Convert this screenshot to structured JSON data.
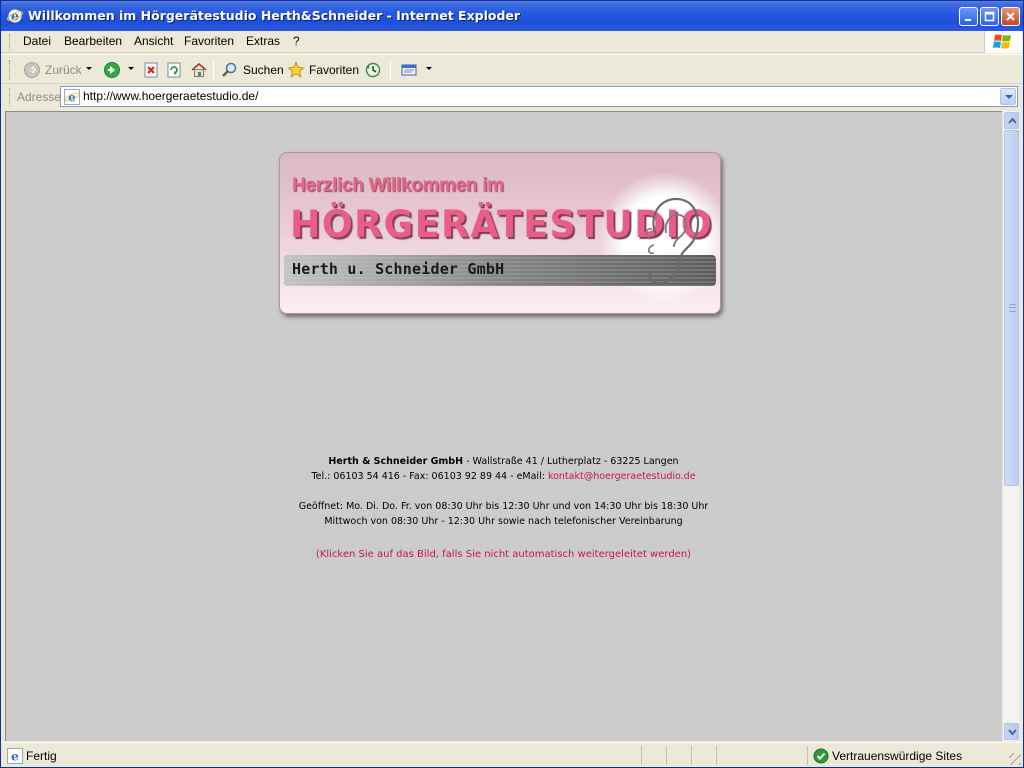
{
  "window": {
    "title": "Willkommen im Hörgerätestudio Herth&Schneider - Internet Exploder"
  },
  "menu": {
    "items": [
      {
        "label": "Datei"
      },
      {
        "label": "Bearbeiten"
      },
      {
        "label": "Ansicht"
      },
      {
        "label": "Favoriten"
      },
      {
        "label": "Extras"
      },
      {
        "label": "?"
      }
    ]
  },
  "toolbar": {
    "back_label": "Zurück",
    "search_label": "Suchen",
    "favorites_label": "Favoriten"
  },
  "address": {
    "label": "Adresse",
    "url": "http://www.hoergeraetestudio.de/"
  },
  "banner": {
    "welcome": "Herzlich Willkommen im",
    "studio": "HÖRGERÄTESTUDIO",
    "company": "Herth u. Schneider GmbH"
  },
  "info": {
    "company_name": "Herth & Schneider GmbH",
    "address_line": " - Wallstraße 41 / Lutherplatz - 63225 Langen",
    "contact_prefix": "Tel.: 06103 54 416 - Fax: 06103 92 89 44 - eMail: ",
    "email": "kontakt@hoergeraetestudio.de",
    "hours_line1": "Geöffnet: Mo. Di. Do. Fr. von 08:30 Uhr bis 12:30 Uhr und von 14:30 Uhr bis 18:30 Uhr",
    "hours_line2": "Mittwoch von 08:30 Uhr - 12:30 Uhr sowie nach telefonischer Vereinbarung",
    "redirect": "(Klicken Sie auf das Bild, falls Sie nicht automatisch weitergeleitet werden)"
  },
  "status": {
    "text": "Fertig",
    "zone": "Vertrauenswürdige Sites"
  },
  "colors": {
    "accent_pink": "#ea5d88",
    "link_red": "#c4164e",
    "page_bg": "#cccccc"
  },
  "icons": [
    "ie-icon",
    "minimize-icon",
    "maximize-icon",
    "close-icon",
    "windows-logo-icon",
    "back-icon",
    "forward-icon",
    "stop-icon",
    "refresh-icon",
    "home-icon",
    "search-icon",
    "favorites-star-icon",
    "history-icon",
    "mail-icon",
    "trusted-zone-icon",
    "ear-icon"
  ]
}
